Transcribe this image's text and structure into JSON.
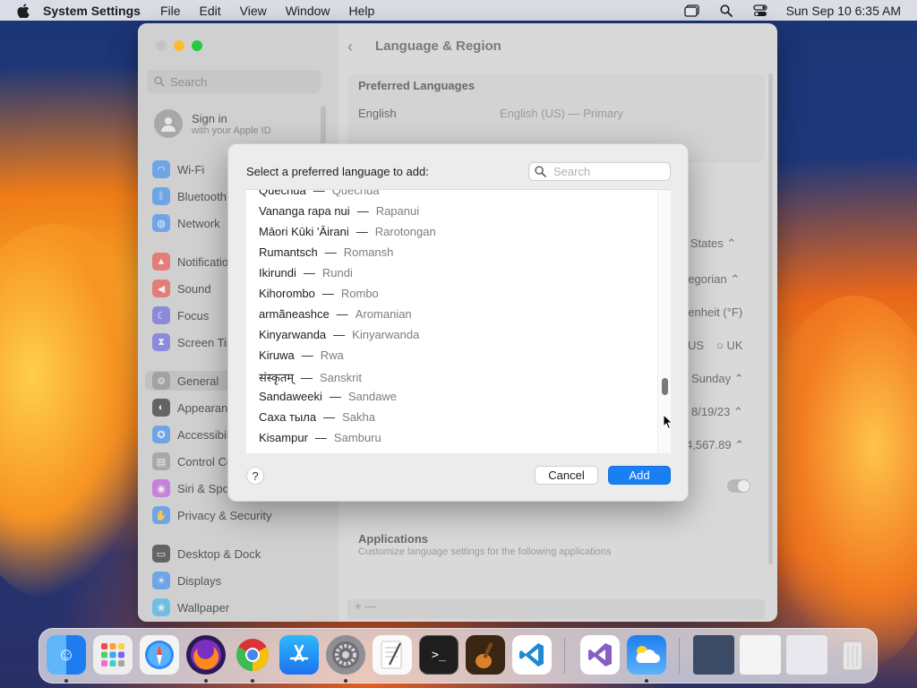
{
  "menubar": {
    "app_name": "System Settings",
    "menus": [
      "File",
      "Edit",
      "View",
      "Window",
      "Help"
    ],
    "datetime": "Sun Sep 10  6:35 AM"
  },
  "sidebar": {
    "search_placeholder": "Search",
    "signin_title": "Sign in",
    "signin_subtitle": "with your Apple ID",
    "items": [
      {
        "label": "Wi-Fi",
        "icon": "wifi-icon",
        "color": "#2f8af5"
      },
      {
        "label": "Bluetooth",
        "icon": "bluetooth-icon",
        "color": "#2f8af5"
      },
      {
        "label": "Network",
        "icon": "globe-icon",
        "color": "#2f8af5"
      },
      {
        "label": "Notifications",
        "icon": "bell-icon",
        "color": "#f0473d"
      },
      {
        "label": "Sound",
        "icon": "speaker-icon",
        "color": "#f0473d"
      },
      {
        "label": "Focus",
        "icon": "moon-icon",
        "color": "#5e5ce6"
      },
      {
        "label": "Screen Time",
        "icon": "hourglass-icon",
        "color": "#5e5ce6"
      },
      {
        "label": "General",
        "icon": "gear-icon",
        "color": "#8e8e93"
      },
      {
        "label": "Appearance",
        "icon": "appearance-icon",
        "color": "#1d1d1f"
      },
      {
        "label": "Accessibility",
        "icon": "accessibility-icon",
        "color": "#2f8af5"
      },
      {
        "label": "Control Centre",
        "icon": "control-centre-icon",
        "color": "#8e8e93"
      },
      {
        "label": "Siri & Spotlight",
        "icon": "siri-icon",
        "color": "#c04de0"
      },
      {
        "label": "Privacy & Security",
        "icon": "hand-icon",
        "color": "#2f8af5"
      },
      {
        "label": "Desktop & Dock",
        "icon": "dock-icon",
        "color": "#1d1d1f"
      },
      {
        "label": "Displays",
        "icon": "display-icon",
        "color": "#2f8af5"
      },
      {
        "label": "Wallpaper",
        "icon": "wallpaper-icon",
        "color": "#2fb2f5"
      }
    ]
  },
  "main": {
    "title": "Language & Region",
    "preferred_languages_heading": "Preferred Languages",
    "language": "English",
    "language_detail": "English (US) — Primary",
    "region_value": "d States",
    "calendar_value": "regorian",
    "temperature_value": "renheit (°F)",
    "measurement_us": "US",
    "measurement_uk": "UK",
    "first_day_value": "Sunday",
    "date_format_value": "8/19/23",
    "number_format_value": "4,567.89",
    "applications_heading": "Applications",
    "applications_subtitle": "Customize language settings for the following applications",
    "bottom_bar": "+  —"
  },
  "sheet": {
    "title": "Select a preferred language to add:",
    "search_placeholder": "Search",
    "languages": [
      {
        "native": "Quechua",
        "english": "Quechua"
      },
      {
        "native": "Vananga rapa nui",
        "english": "Rapanui"
      },
      {
        "native": "Māori Kūki 'Āirani",
        "english": "Rarotongan"
      },
      {
        "native": "Rumantsch",
        "english": "Romansh"
      },
      {
        "native": "Ikirundi",
        "english": "Rundi"
      },
      {
        "native": "Kihorombo",
        "english": "Rombo"
      },
      {
        "native": "armãneashce",
        "english": "Aromanian"
      },
      {
        "native": "Kinyarwanda",
        "english": "Kinyarwanda"
      },
      {
        "native": "Kiruwa",
        "english": "Rwa"
      },
      {
        "native": "संस्कृतम्",
        "english": "Sanskrit"
      },
      {
        "native": "Sandaweeki",
        "english": "Sandawe"
      },
      {
        "native": "Саха тыла",
        "english": "Sakha"
      },
      {
        "native": "Kisampur",
        "english": "Samburu"
      }
    ],
    "dash": "—",
    "help_label": "?",
    "cancel_label": "Cancel",
    "add_label": "Add"
  },
  "dock": {
    "apps": [
      {
        "name": "finder-icon",
        "color": "#3c9df6"
      },
      {
        "name": "launchpad-icon",
        "color": "#f2f2f2"
      },
      {
        "name": "safari-icon",
        "color": "#2f8af5"
      },
      {
        "name": "firefox-icon",
        "color": "#5b2a86"
      },
      {
        "name": "chrome-icon",
        "color": "#ffffff"
      },
      {
        "name": "app-store-icon",
        "color": "#1b8ef5"
      },
      {
        "name": "system-settings-icon",
        "color": "#8e8e93"
      },
      {
        "name": "textedit-icon",
        "color": "#f5f5f5"
      },
      {
        "name": "terminal-icon",
        "color": "#1e1e1e"
      },
      {
        "name": "instruments-icon",
        "color": "#3a2a1a"
      },
      {
        "name": "vscode-icon",
        "color": "#ffffff"
      },
      {
        "name": "visual-studio-icon",
        "color": "#ffffff"
      },
      {
        "name": "weather-icon",
        "color": "#2f8af5"
      }
    ]
  }
}
